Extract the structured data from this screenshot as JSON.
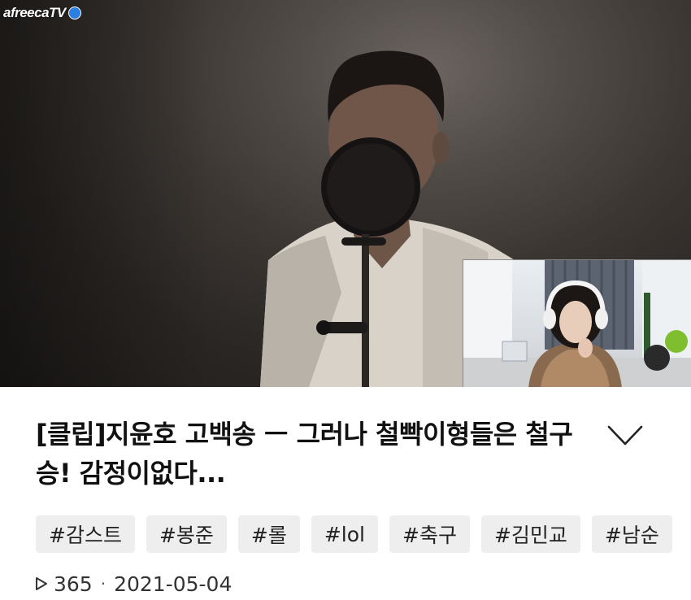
{
  "player": {
    "brand_text": "afreecaTV",
    "brand_icon": "tv-mascot-icon"
  },
  "video": {
    "title": "[클립]지윤호 고백송 ㅡ 그러나 철빡이형들은 철구승! 감정이없다...",
    "expand_icon": "chevron-down-icon"
  },
  "tags": [
    "#감스트",
    "#봉준",
    "#롤",
    "#lol",
    "#축구",
    "#김민교",
    "#남순"
  ],
  "meta": {
    "views_icon": "play-outline-icon",
    "views": "365",
    "separator": "·",
    "date": "2021-05-04"
  },
  "colors": {
    "background": "#ffffff",
    "tag_background": "#eeeeee",
    "text": "#111111",
    "accent_logo": "#2a7fe0"
  }
}
